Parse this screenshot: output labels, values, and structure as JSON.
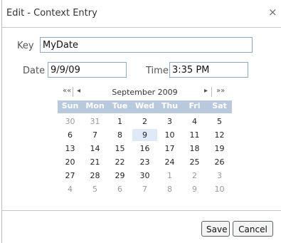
{
  "dialog": {
    "title": "Edit - Context Entry",
    "close_glyph": "×"
  },
  "form": {
    "key_label": "Key",
    "key_value": "MyDate",
    "date_label": "Date",
    "date_value": "9/9/09",
    "time_label": "Time",
    "time_value": "3:35 PM"
  },
  "calendar": {
    "prev_year": "««",
    "prev_month": "◂",
    "next_month": "▸",
    "next_year": "»»",
    "month_label": "September 2009",
    "weekdays": [
      "Sun",
      "Mon",
      "Tue",
      "Wed",
      "Thu",
      "Fri",
      "Sat"
    ],
    "weeks": [
      [
        "30",
        "31",
        "1",
        "2",
        "3",
        "4",
        "5"
      ],
      [
        "6",
        "7",
        "8",
        "9",
        "10",
        "11",
        "12"
      ],
      [
        "13",
        "14",
        "15",
        "16",
        "17",
        "18",
        "19"
      ],
      [
        "20",
        "21",
        "22",
        "23",
        "24",
        "25",
        "26"
      ],
      [
        "27",
        "28",
        "29",
        "30",
        "1",
        "2",
        "3"
      ],
      [
        "4",
        "5",
        "6",
        "7",
        "8",
        "9",
        "10"
      ]
    ],
    "selected_day": "9"
  },
  "buttons": {
    "save": "Save",
    "cancel": "Cancel"
  }
}
